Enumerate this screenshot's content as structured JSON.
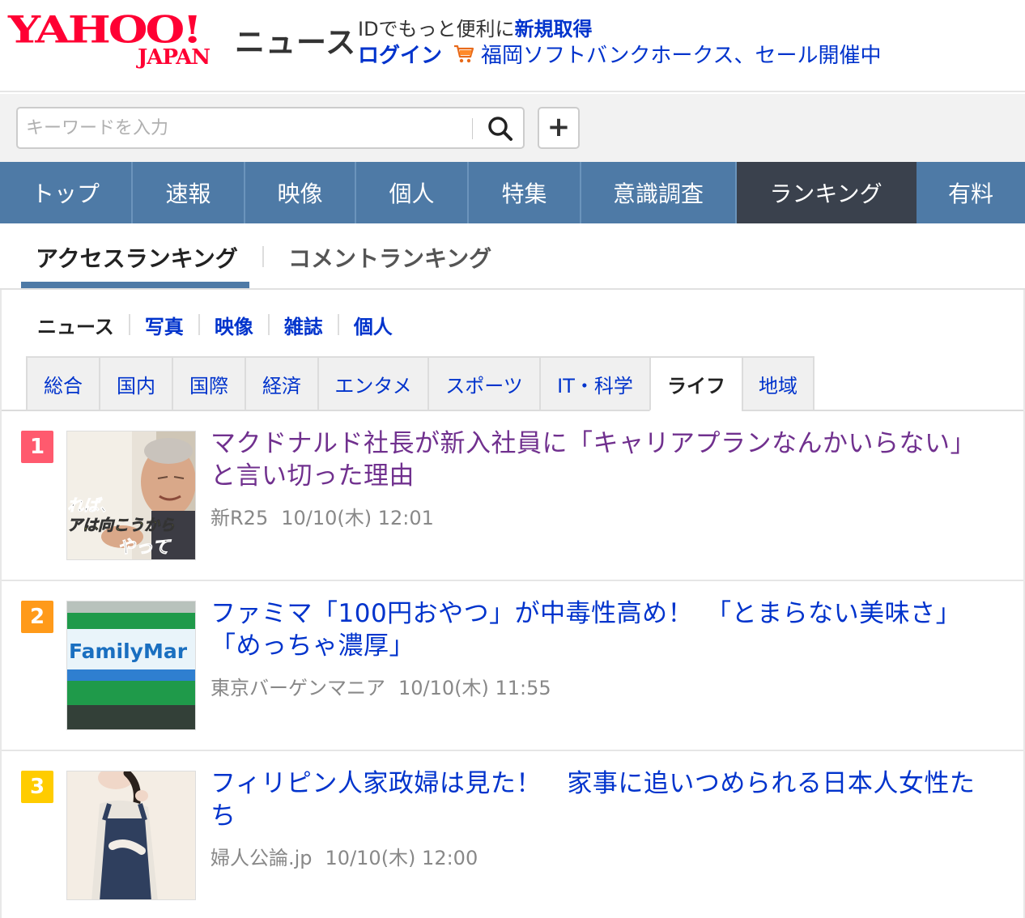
{
  "header": {
    "logo_main": "YAHOO!",
    "logo_sub": "JAPAN",
    "logo_news": "ニュース",
    "id_text": "IDでもっと便利に",
    "id_link": "新規取得",
    "login_label": "ログイン",
    "promo_text": "福岡ソフトバンクホークス、セール開催中"
  },
  "search": {
    "placeholder": "キーワードを入力",
    "plus_label": "+"
  },
  "nav": {
    "items": [
      "トップ",
      "速報",
      "映像",
      "個人",
      "特集",
      "意識調査",
      "ランキング",
      "有料"
    ]
  },
  "ranking_tabs": {
    "access": "アクセスランキング",
    "comment": "コメントランキング"
  },
  "subnav": {
    "items": [
      "ニュース",
      "写真",
      "映像",
      "雑誌",
      "個人"
    ]
  },
  "categories": {
    "items": [
      "総合",
      "国内",
      "国際",
      "経済",
      "エンタメ",
      "スポーツ",
      "IT・科学",
      "ライフ",
      "地域"
    ]
  },
  "colors": {
    "brand_red": "#ff0033",
    "link_blue": "#0033cc",
    "visited_purple": "#70308e",
    "nav_blue": "#4e7aa6",
    "nav_active": "#3a414d",
    "rank1": "#ff5a6e",
    "rank2": "#ff9a1a",
    "rank3": "#ffcc00"
  },
  "articles": [
    {
      "rank": "1",
      "title": "マクドナルド社長が新入社員に「キャリアプランなんかいらない」と言い切った理由",
      "source": "新R25",
      "date": "10/10(木) 12:01",
      "thumb_text_1": "れば、",
      "thumb_text_2": "アは向こうから",
      "thumb_text_3": "やって"
    },
    {
      "rank": "2",
      "title": "ファミマ「100円おやつ」が中毒性高め！　「とまらない美味さ」「めっちゃ濃厚」",
      "source": "東京バーゲンマニア",
      "date": "10/10(木) 11:55",
      "thumb_text_1": "FamilyMar"
    },
    {
      "rank": "3",
      "title": "フィリピン人家政婦は見た！　家事に追いつめられる日本人女性たち",
      "source": "婦人公論.jp",
      "date": "10/10(木) 12:00"
    }
  ]
}
